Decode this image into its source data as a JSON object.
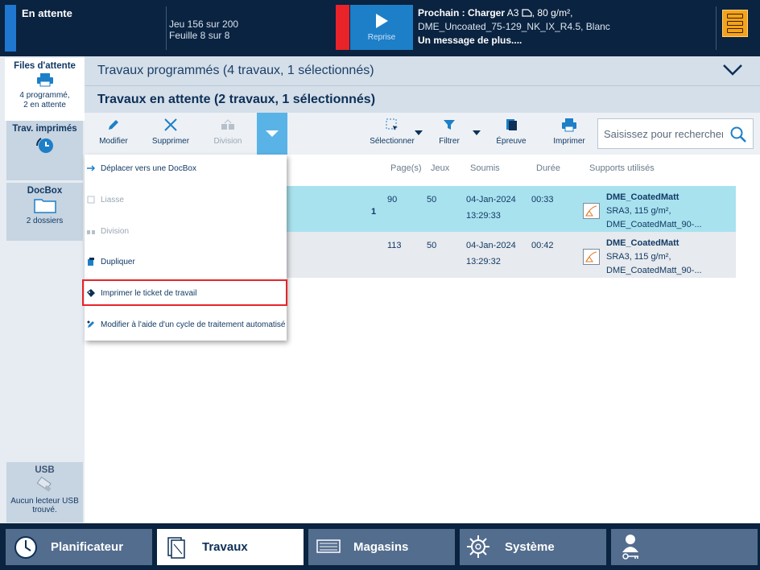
{
  "topbar": {
    "status": "En attente",
    "counts_line1": "Jeu 156 sur 200",
    "counts_line2": "Feuille 8 sur 8",
    "resume_label": "Reprise",
    "next_title": "Prochain : Charger",
    "next_size": "A3",
    "next_weight": ", 80 g/m²,",
    "next_media": "DME_Uncoated_75-129_NK_IX_R4.5, Blanc",
    "next_message": "Un message de plus...."
  },
  "sidebar": {
    "queue": {
      "title": "Files d'attente",
      "line1": "4 programmé,",
      "line2": "2 en attente"
    },
    "printed": {
      "title": "Trav. imprimés"
    },
    "docbox": {
      "title": "DocBox",
      "sub": "2 dossiers"
    },
    "usb": {
      "title": "USB",
      "sub1": "Aucun lecteur USB",
      "sub2": "trouvé."
    }
  },
  "scheduled_title": "Travaux programmés (4 travaux, 1 sélectionnés)",
  "waiting_title": "Travaux en attente (2 travaux, 1 sélectionnés)",
  "toolbar": {
    "edit": "Modifier",
    "delete": "Supprimer",
    "split": "Division",
    "select": "Sélectionner",
    "filter": "Filtrer",
    "proof": "Épreuve",
    "print": "Imprimer"
  },
  "search": {
    "placeholder": "Saisissez pour rechercher"
  },
  "columns": {
    "pages": "Page(s)",
    "sets": "Jeux",
    "submitted": "Soumis",
    "duration": "Durée",
    "media": "Supports utilisés"
  },
  "jobs": [
    {
      "flag": "1",
      "pages": "90",
      "sets": "50",
      "date": "04-Jan-2024",
      "time": "13:29:33",
      "duration": "00:33",
      "media_name": "DME_CoatedMatt",
      "media_spec": "SRA3, 115 g/m²,",
      "media_full": "DME_CoatedMatt_90-..."
    },
    {
      "flag": "",
      "pages": "113",
      "sets": "50",
      "date": "04-Jan-2024",
      "time": "13:29:32",
      "duration": "00:42",
      "media_name": "DME_CoatedMatt",
      "media_spec": "SRA3, 115 g/m²,",
      "media_full": "DME_CoatedMatt_90-..."
    }
  ],
  "dropdown": [
    "Déplacer vers une DocBox",
    "Liasse",
    "Division",
    "Dupliquer",
    "Imprimer le ticket de travail",
    "Modifier à l'aide d'un cycle de traitement automatisé"
  ],
  "footer": {
    "planner": "Planificateur",
    "jobs": "Travaux",
    "trays": "Magasins",
    "system": "Système"
  },
  "colors": {
    "accent": "#1d7fc8",
    "selected_row": "#a9e2ef",
    "alert": "#e8232a",
    "menu": "#f5a21b"
  }
}
